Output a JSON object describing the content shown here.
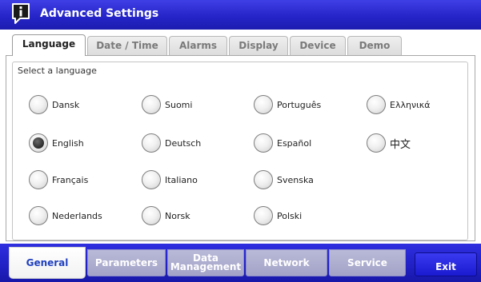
{
  "window": {
    "title": "Advanced Settings",
    "icon": "info-speech-bubble-icon"
  },
  "top_tabs": [
    {
      "label": "Language",
      "active": true
    },
    {
      "label": "Date / Time",
      "active": false
    },
    {
      "label": "Alarms",
      "active": false
    },
    {
      "label": "Display",
      "active": false
    },
    {
      "label": "Device",
      "active": false
    },
    {
      "label": "Demo",
      "active": false
    }
  ],
  "language_panel": {
    "label": "Select a language",
    "selected": "English",
    "options": [
      {
        "label": "Dansk",
        "checked": false
      },
      {
        "label": "English",
        "checked": true
      },
      {
        "label": "Français",
        "checked": false
      },
      {
        "label": "Nederlands",
        "checked": false
      },
      {
        "label": "Suomi",
        "checked": false
      },
      {
        "label": "Deutsch",
        "checked": false
      },
      {
        "label": "Italiano",
        "checked": false
      },
      {
        "label": "Norsk",
        "checked": false
      },
      {
        "label": "Português",
        "checked": false
      },
      {
        "label": "Español",
        "checked": false
      },
      {
        "label": "Svenska",
        "checked": false
      },
      {
        "label": "Polski",
        "checked": false
      },
      {
        "label": "Ελληνικά",
        "checked": false
      },
      {
        "label": "中文",
        "checked": false
      }
    ]
  },
  "bottom_tabs": [
    {
      "label": "General",
      "active": true
    },
    {
      "label": "Parameters",
      "active": false
    },
    {
      "label": "Data\nManagement",
      "active": false
    },
    {
      "label": "Network",
      "active": false
    },
    {
      "label": "Service",
      "active": false
    }
  ],
  "exit_button": {
    "label": "Exit"
  },
  "colors": {
    "title_bar": "#2525c9",
    "bottom_bar": "#2020c4",
    "active_bottom_tab_text": "#1f3fbf",
    "inactive_tab_text": "#7a7a7a"
  }
}
